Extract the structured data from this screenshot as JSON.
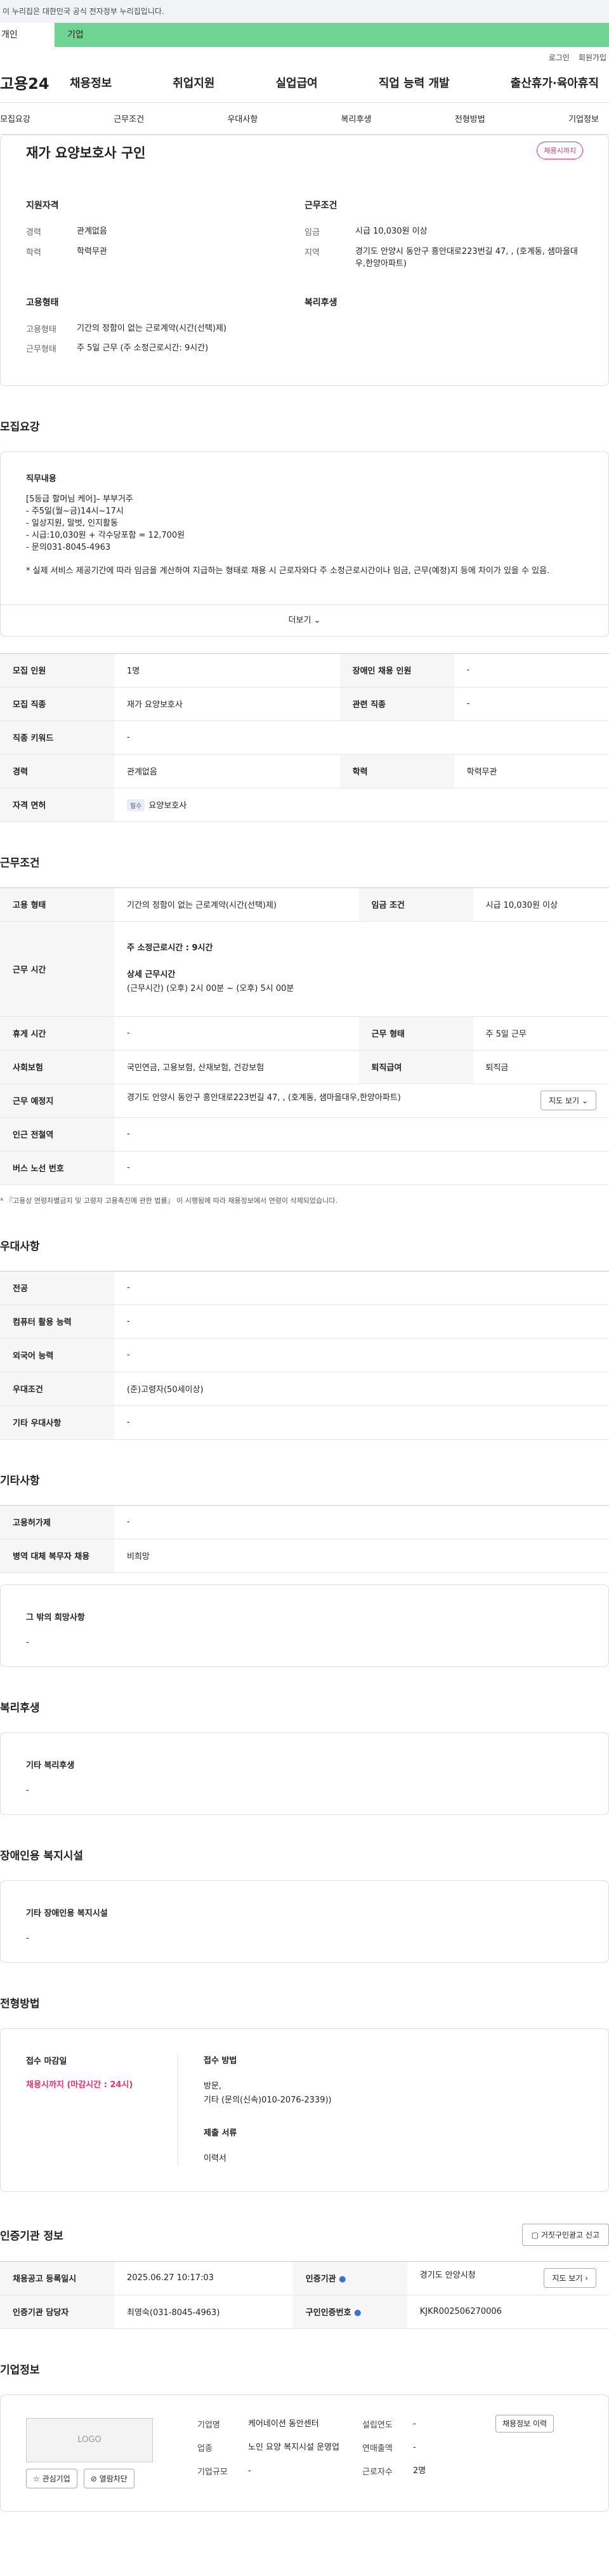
{
  "gov_banner": "이 누리집은 대한민국 공식 전자정부 누리집입니다.",
  "top_tabs": {
    "personal": "개인",
    "company": "기업"
  },
  "util": {
    "login": "로그인",
    "signup": "회원가입"
  },
  "logo": "고용24",
  "gnb": [
    "채용정보",
    "취업지원",
    "실업급여",
    "직업 능력 개발",
    "출산휴가·육아휴직"
  ],
  "anchor_nav": [
    "모집요강",
    "근무조건",
    "우대사항",
    "복리후생",
    "전형방법",
    "기업정보"
  ],
  "summary": {
    "title": "재가 요양보호사 구인",
    "badge": "채용시까지",
    "applicant_heading": "지원자격",
    "career_label": "경력",
    "career_value": "관계없음",
    "edu_label": "학력",
    "edu_value": "학력무관",
    "work_heading": "근무조건",
    "wage_label": "임금",
    "wage_value": "시급 10,030원 이상",
    "region_label": "지역",
    "region_value": "경기도 안양시 동안구 흥안대로223번길 47, , (호계동, 샘마을대우,한양아파트)",
    "employ_heading": "고용형태",
    "employ_type_label": "고용형태",
    "employ_type_value": "기간의 정함이 없는 근로계약(시간(선택)제)",
    "work_type_label": "근무형태",
    "work_type_value": "주 5일 근무 (주 소정근로시간: 9시간)",
    "welfare_heading": "복리후생"
  },
  "recruit": {
    "section_title": "모집요강",
    "desc_heading": "직무내용",
    "desc_lines": [
      "[5등급 할머님 케어]– 부부거주",
      "- 주5일(월~금)14시~17시",
      "- 일상지원, 말벗, 인지활동",
      "- 시급:10,030원 + 각수당포함 = 12,700원",
      "- 문의031-8045-4963",
      "",
      "* 실제 서비스 제공기간에 따라 임금을 계산하여 지급하는 형태로 채용 시 근로자와다 주 소정근로시간이나 임금, 근무(예정)지 등에 차이가 있을 수 있음."
    ],
    "more_label": "더보기",
    "rows": [
      [
        "모집 인원",
        "1명",
        "장애인 채용 인원",
        "-"
      ],
      [
        "모집 직종",
        "재가 요양보호사",
        "관련 직종",
        "-"
      ],
      [
        "직종 키워드",
        "-"
      ],
      [
        "경력",
        "관계없음",
        "학력",
        "학력무관"
      ],
      [
        "자격 면허",
        "요양보호사"
      ]
    ],
    "chip": "필수"
  },
  "conditions": {
    "section_title": "근무조건",
    "employ_label": "고용 형태",
    "employ_value": "기간의 정함이 없는 근로계약(시간(선택)제)",
    "wage_label": "임금 조건",
    "wage_value": "시급 10,030원 이상",
    "hours_label": "근무 시간",
    "hours_weekly": "주 소정근로시간 : 9시간",
    "hours_detail_heading": "상세 근무시간",
    "hours_detail": "(근무시간) (오후) 2시 00분 ~ (오후) 5시 00분",
    "holiday_label": "휴게 시간",
    "holiday_value": "-",
    "worktype_label": "근무 형태",
    "worktype_value": "주 5일 근무",
    "insurance_label": "사회보험",
    "insurance_value": "국민연금, 고용보험, 산재보험, 건강보험",
    "retire_label": "퇴직급여",
    "retire_value": "퇴직금",
    "place_label": "근무 예정지",
    "place_value": "경기도 안양시 동안구 흥안대로223번길 47, , (호계동, 샘마을대우,한양아파트)",
    "map_btn": "지도 보기",
    "subway_label": "인근 전철역",
    "subway_value": "-",
    "bus_label": "버스 노선 번호",
    "bus_value": "-",
    "notice": "* 『고용상 연령차별금지 및 고령자 고용촉진에 관한 법률』 이 시행됨에 따라 채용정보에서 연령이 삭제되었습니다."
  },
  "preference": {
    "section_title": "우대사항",
    "rows": [
      [
        "전공",
        "-"
      ],
      [
        "컴퓨터 활용 능력",
        "-"
      ],
      [
        "외국어 능력",
        "-"
      ],
      [
        "우대조건",
        "(준)고령자(50세이상)"
      ],
      [
        "기타 우대사항",
        "-"
      ]
    ]
  },
  "etc": {
    "section_title": "기타사항",
    "rows": [
      [
        "고용허가제",
        "-"
      ],
      [
        "병역 대체 복무자 채용",
        "비희망"
      ]
    ],
    "other_heading": "그 밖의 희망사항",
    "other_value": "-"
  },
  "welfare": {
    "section_title": "복리후생",
    "heading": "기타 복리후생",
    "value": "-"
  },
  "disabled": {
    "section_title": "장애인용 복지시설",
    "heading": "기타 장애인용 복지시설",
    "value": "-"
  },
  "selection": {
    "section_title": "전형방법",
    "deadline_heading": "접수 마감일",
    "deadline_value": "채용시까지 (마감시간 : 24시)",
    "method_heading": "접수 방법",
    "method_value1": "방문,",
    "method_value2": "기타 (문의(신속)010-2076-2339))",
    "docs_heading": "제출 서류",
    "docs_value": "이력서"
  },
  "agency": {
    "section_title": "인증기관 정보",
    "report_btn": "거짓구인광고 신고",
    "reg_label": "채용공고 등록일시",
    "reg_value": "2025.06.27 10:17:03",
    "agency_label": "인증기관",
    "agency_value": "경기도 안양시청",
    "map_btn": "지도 보기",
    "manager_label": "인증기관 담당자",
    "manager_value": "최영숙(031-8045-4963)",
    "code_label": "구인인증번호",
    "code_value": "KJKR002506270006"
  },
  "company": {
    "section_title": "기업정보",
    "logo_text": "LOGO",
    "fav_btn": "관심기업",
    "block_btn": "열람차단",
    "name_label": "기업명",
    "name_value": "케어네이션 동안센터",
    "biz_label": "업종",
    "biz_value": "노인 요양 복지시설 운영업",
    "size_label": "기업규모",
    "size_value": "-",
    "found_label": "설립연도",
    "found_value": "-",
    "sales_label": "연매출액",
    "sales_value": "-",
    "emp_label": "근로자수",
    "emp_value": "2명",
    "jobs_btn": "채용정보 이력"
  },
  "colors": {
    "accent_green": "#6fd392",
    "badge_red": "#e8336f"
  }
}
